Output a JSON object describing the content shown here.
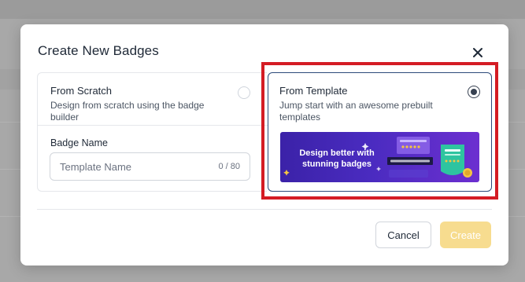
{
  "modal": {
    "title": "Create New Badges",
    "close_icon": "close-icon"
  },
  "options": {
    "scratch": {
      "title": "From Scratch",
      "description": "Design from scratch using the badge builder",
      "selected": false
    },
    "template": {
      "title": "From Template",
      "description": "Jump start with an awesome prebuilt templates",
      "selected": true,
      "banner_text": "Design better with stunning badges"
    }
  },
  "badge_name": {
    "label": "Badge Name",
    "placeholder": "Template Name",
    "value": "",
    "char_count": "0 / 80"
  },
  "footer": {
    "cancel_label": "Cancel",
    "create_label": "Create"
  },
  "colors": {
    "highlight": "#d41c24",
    "create_button": "#f7dc8f",
    "selected_border": "#2c4a7a",
    "banner": "#4a2bc0"
  }
}
